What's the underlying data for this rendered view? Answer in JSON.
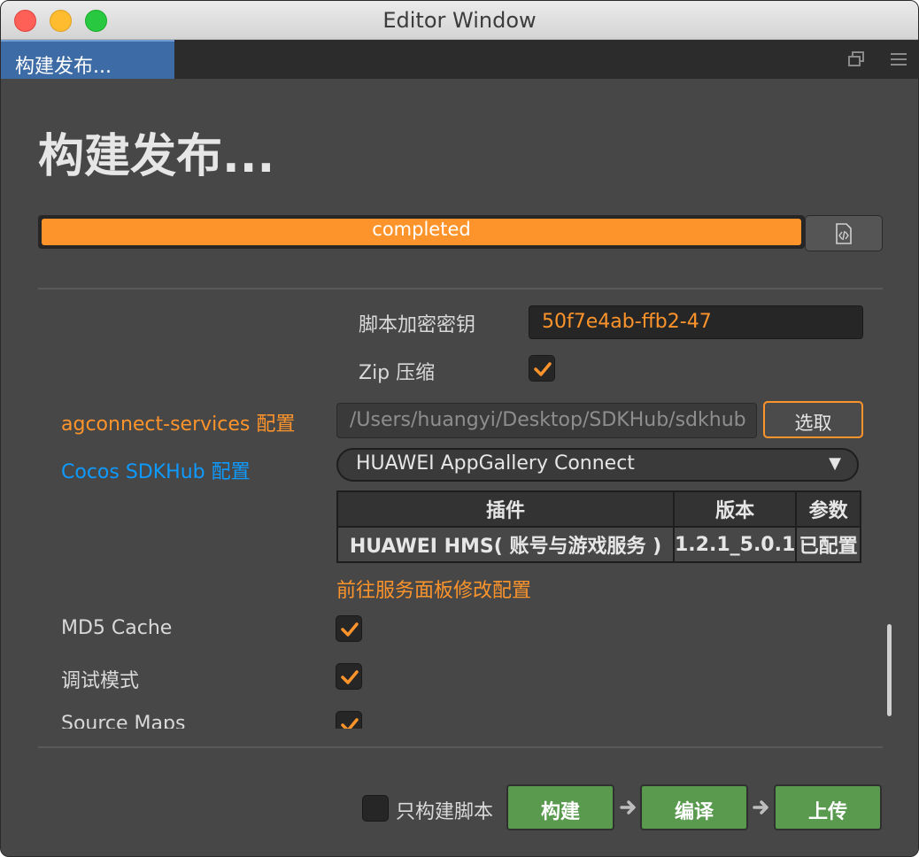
{
  "window": {
    "title": "Editor Window"
  },
  "tabbar": {
    "tab_label": "构建发布...",
    "icons": [
      "popout-icon",
      "menu-icon"
    ]
  },
  "page": {
    "title": "构建发布...",
    "progress": {
      "text": "completed",
      "percent": 100,
      "color": "#fd942b"
    },
    "log_button_icon": "code-file-icon"
  },
  "settings": {
    "encrypt_key_label": "脚本加密密钥",
    "encrypt_key_value": "50f7e4ab-ffb2-47",
    "zip_label": "Zip 压缩",
    "zip_checked": true,
    "agconnect_label": "agconnect-services 配置",
    "agconnect_path": "/Users/huangyi/Desktop/SDKHub/sdkhub",
    "select_button": "选取",
    "sdkhub_label": "Cocos SDKHub 配置",
    "sdkhub_selected": "HUAWEI AppGallery Connect",
    "table": {
      "headers": [
        "插件",
        "版本",
        "参数"
      ],
      "rows": [
        [
          "HUAWEI HMS( 账号与游戏服务 )",
          "1.2.1_5.0.1",
          "已配置"
        ]
      ]
    },
    "service_link": "前往服务面板修改配置",
    "md5_label": "MD5 Cache",
    "md5_checked": true,
    "debug_label": "调试模式",
    "debug_checked": true,
    "sourcemaps_label": "Source Maps",
    "sourcemaps_checked": true
  },
  "footer": {
    "script_only_label": "只构建脚本",
    "script_only_checked": false,
    "build_button": "构建",
    "compile_button": "编译",
    "upload_button": "上传"
  },
  "colors": {
    "accent_orange": "#fd942b",
    "link_blue": "#0e9aff",
    "button_green": "#5a9a4f"
  }
}
